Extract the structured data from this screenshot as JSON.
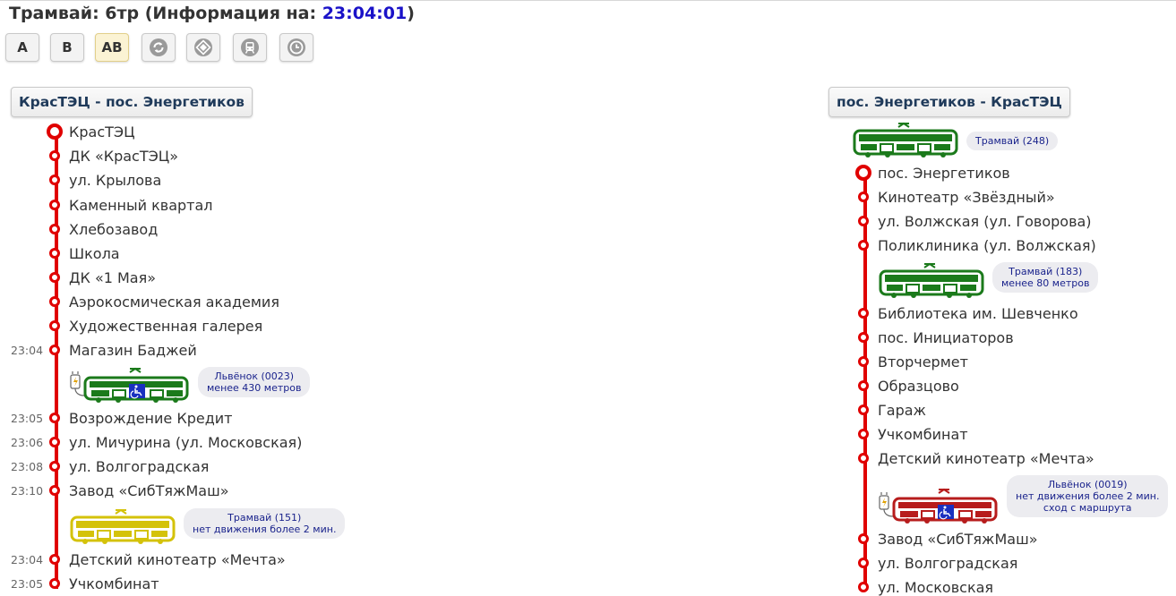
{
  "header": {
    "title_prefix": "Трамвай: 6тр (Информация на: ",
    "time": "23:04:01",
    "title_suffix": ")"
  },
  "toolbar": {
    "buttons": [
      {
        "label": "A",
        "active": false
      },
      {
        "label": "B",
        "active": false
      },
      {
        "label": "AB",
        "active": true
      }
    ],
    "icons": [
      "refresh-icon",
      "map-icon",
      "vehicle-icon",
      "clock-icon"
    ]
  },
  "colors": {
    "route_line": "#e00000",
    "tram_green": "#1b7a1b",
    "tram_yellow": "#d4c20a",
    "tram_red": "#b71c1c",
    "time_highlight": "#1a12c8"
  },
  "directions": [
    {
      "title": "КрасТЭЦ - пос. Энергетиков",
      "stops": [
        {
          "name": "КрасТЭЦ",
          "time": ""
        },
        {
          "name": "ДК «КрасТЭЦ»",
          "time": ""
        },
        {
          "name": "ул. Крылова",
          "time": ""
        },
        {
          "name": "Каменный квартал",
          "time": ""
        },
        {
          "name": "Хлебозавод",
          "time": ""
        },
        {
          "name": "Школа",
          "time": ""
        },
        {
          "name": "ДК «1 Мая»",
          "time": ""
        },
        {
          "name": "Аэрокосмическая академия",
          "time": ""
        },
        {
          "name": "Художественная галерея",
          "time": ""
        },
        {
          "name": "Магазин Баджей",
          "time": "23:04"
        },
        {
          "name": "Возрождение Кредит",
          "time": "23:05"
        },
        {
          "name": "ул. Мичурина (ул. Московская)",
          "time": "23:06"
        },
        {
          "name": "ул. Волгоградская",
          "time": "23:08"
        },
        {
          "name": "Завод «СибТяжМаш»",
          "time": "23:10"
        },
        {
          "name": "Детский кинотеатр «Мечта»",
          "time": "23:04"
        },
        {
          "name": "Учкомбинат",
          "time": "23:05"
        }
      ],
      "vehicles": [
        {
          "line1": "Львёнок (0023)",
          "line2": "менее 430 метров",
          "line3": "",
          "color": "green",
          "accessible": true,
          "electric": true
        },
        {
          "line1": "Трамвай (151)",
          "line2": "нет движения более 2 мин.",
          "line3": "",
          "color": "yellow",
          "accessible": false,
          "electric": false
        }
      ]
    },
    {
      "title": "пос. Энергетиков - КрасТЭЦ",
      "stops": [
        {
          "name": "пос. Энергетиков"
        },
        {
          "name": "Кинотеатр «Звёздный»"
        },
        {
          "name": "ул. Волжская (ул. Говорова)"
        },
        {
          "name": "Поликлиника (ул. Волжская)"
        },
        {
          "name": "Библиотека им. Шевченко"
        },
        {
          "name": "пос. Инициаторов"
        },
        {
          "name": "Вторчермет"
        },
        {
          "name": "Образцово"
        },
        {
          "name": "Гараж"
        },
        {
          "name": "Учкомбинат"
        },
        {
          "name": "Детский кинотеатр «Мечта»"
        },
        {
          "name": "Завод «СибТяжМаш»"
        },
        {
          "name": "ул. Волгоградская"
        },
        {
          "name": "ул. Московская"
        }
      ],
      "vehicles": [
        {
          "line1": "Трамвай (248)",
          "line2": "",
          "line3": "",
          "color": "green",
          "accessible": false,
          "electric": false
        },
        {
          "line1": "Трамвай (183)",
          "line2": "менее 80 метров",
          "line3": "",
          "color": "green",
          "accessible": false,
          "electric": false
        },
        {
          "line1": "Львёнок (0019)",
          "line2": "нет движения более 2 мин.",
          "line3": "сход с маршрута",
          "color": "red",
          "accessible": true,
          "electric": true
        }
      ]
    }
  ]
}
